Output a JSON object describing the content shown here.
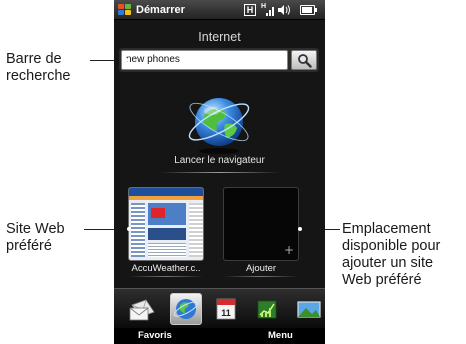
{
  "annotations": {
    "search_bar": [
      "Barre de",
      "recherche"
    ],
    "favorite_site": [
      "Site Web",
      "préféré"
    ],
    "empty_slot": [
      "Emplacement",
      "disponible pour",
      "ajouter un site",
      "Web préféré"
    ]
  },
  "statusbar": {
    "start_label": "Démarrer",
    "icons": [
      "windows-flag-icon",
      "h-network-icon",
      "signal-icon",
      "speaker-icon",
      "battery-icon"
    ]
  },
  "app": {
    "title": "Internet",
    "search": {
      "value": "new phones",
      "button_icon": "magnifier-icon"
    },
    "browser": {
      "label": "Lancer le navigateur",
      "icon": "globe-icon"
    },
    "favorites": [
      {
        "label": "AccuWeather.c..",
        "kind": "site-thumbnail"
      },
      {
        "label": "Ajouter",
        "kind": "empty-slot",
        "icon": "plus-icon"
      }
    ]
  },
  "tabbar": {
    "tabs": [
      {
        "name": "mail-tab",
        "icon": "envelope-icon"
      },
      {
        "name": "internet-tab",
        "icon": "globe-icon",
        "selected": true
      },
      {
        "name": "calendar-tab",
        "icon": "calendar-icon",
        "text": "11"
      },
      {
        "name": "stocks-tab",
        "icon": "chart-icon"
      },
      {
        "name": "photos-tab",
        "icon": "photo-icon"
      }
    ],
    "left_softkey": "Favoris",
    "right_softkey": "Menu"
  },
  "colors": {
    "phone_bg": "#151515",
    "accent_blue": "#2f6fd0"
  }
}
